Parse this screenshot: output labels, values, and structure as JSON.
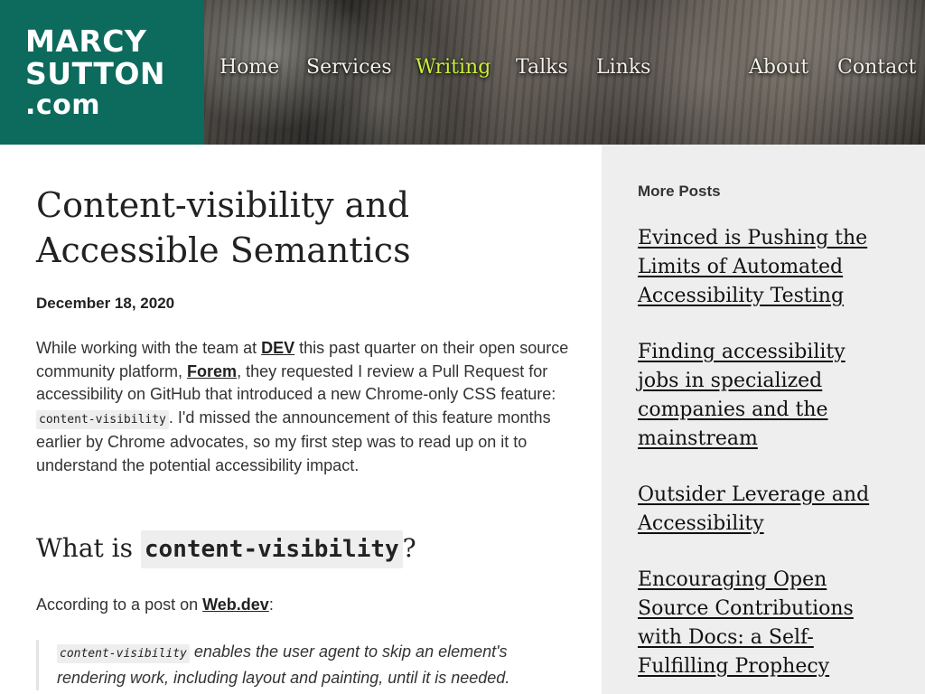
{
  "site": {
    "logo_line1": "MARCY",
    "logo_line2": "SUTTON",
    "logo_line3": ".com"
  },
  "nav": {
    "items": [
      {
        "label": "Home"
      },
      {
        "label": "Services"
      },
      {
        "label": "Writing"
      },
      {
        "label": "Talks"
      },
      {
        "label": "Links"
      },
      {
        "label": "About"
      },
      {
        "label": "Contact"
      }
    ],
    "active": "Writing"
  },
  "post": {
    "title": "Content-visibility and Accessible Semantics",
    "date": "December 18, 2020",
    "para1_a": "While working with the team at ",
    "para1_link1": "DEV",
    "para1_b": " this past quarter on their open source community platform, ",
    "para1_link2": "Forem",
    "para1_c": ", they requested I review a Pull Request for accessibility on GitHub that introduced a new Chrome-only CSS feature: ",
    "para1_code": "content-visibility",
    "para1_d": ". I'd missed the announcement of this feature months earlier by Chrome advocates, so my first step was to read up on it to understand the potential accessibility impact.",
    "h2_prefix": "What is ",
    "h2_code": "content-visibility",
    "h2_suffix": "?",
    "according_text": "According to a post on ",
    "according_link": "Web.dev",
    "according_colon": ":",
    "quote_code": "content-visibility",
    "quote_text": " enables the user agent to skip an element's rendering work, including layout and painting, until it is needed."
  },
  "sidebar": {
    "heading": "More Posts",
    "posts": [
      {
        "title": "Evinced is Pushing the Limits of Automated Accessibility Testing"
      },
      {
        "title": "Finding accessibility jobs in specialized companies and the mainstream"
      },
      {
        "title": "Outsider Leverage and Accessibility"
      },
      {
        "title": "Encouraging Open Source Contributions with Docs: a Self-Fulfilling Prophecy"
      }
    ]
  },
  "colors": {
    "logo_bg": "#0c6b5d",
    "nav_active": "#c9f03a",
    "sidebar_bg": "#eeeeee"
  }
}
